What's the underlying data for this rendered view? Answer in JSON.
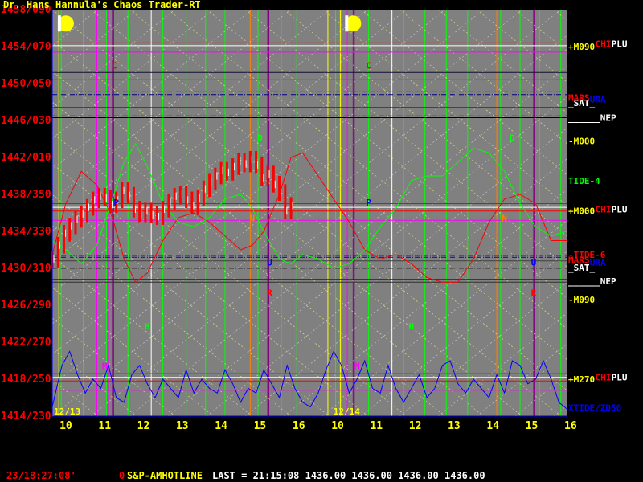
{
  "app": {
    "title": "Dr. Hans Hannula's Chaos Trader-RT"
  },
  "status": {
    "clock": "23/18:27:08'",
    "flag": "0",
    "symbol": "S&P-AMHOTLINE",
    "quote": "LAST = 21:15:08 1436.00 1436.00 1436.00 1436.00"
  },
  "colors": {
    "background": "#000000",
    "plot_bg": "#808080",
    "title": "#ffff00",
    "y_labels": "#ff0000",
    "x_labels": "#ffff00",
    "price_bars": "#ff0000",
    "price_up": "#ffffff",
    "tide": "#ff0000",
    "tide4": "#00ff00",
    "xtide": "#0000ff",
    "xtide_label": "#0000ff",
    "moon": "#ffff00",
    "time_text": "#ff0000",
    "symbol_text": "#ffff00",
    "quote_text": "#ffffff"
  },
  "chart_data": {
    "type": "line",
    "title": "Dr. Hans Hannula's Chaos Trader-RT",
    "y_tick_labels": [
      "1458/090",
      "1454/070",
      "1450/050",
      "1446/030",
      "1442/010",
      "1438/350",
      "1434/330",
      "1430/310",
      "1426/290",
      "1422/270",
      "1418/250",
      "1414/230"
    ],
    "y_ticks": [
      1458,
      1454,
      1450,
      1446,
      1442,
      1438,
      1434,
      1430,
      1426,
      1422,
      1418,
      1414
    ],
    "ylim": [
      1414,
      1458
    ],
    "x_tick_labels": [
      "10",
      "11",
      "12",
      "13",
      "14",
      "15",
      "16",
      "10",
      "11",
      "12",
      "13",
      "14",
      "15",
      "16"
    ],
    "x_ticks": [
      9.5,
      10.5,
      11.5,
      12.5,
      13.5,
      14.5,
      15.5,
      16.5,
      17.5,
      18.5,
      19.5,
      20.5,
      21.5,
      22.5
    ],
    "xlim": [
      9.15,
      22.4
    ],
    "date_labels": [
      {
        "text": "12/13",
        "x": 9.15
      },
      {
        "text": "12/14",
        "x": 16.35
      }
    ],
    "right_labels": [
      {
        "text": "+M090",
        "y": 1454.0,
        "color": "#ffff00"
      },
      {
        "text": "CHI",
        "y": 1454.3,
        "color": "#ff0000"
      },
      {
        "text": "PLU",
        "y": 1454.3,
        "color": "#ffffff"
      },
      {
        "text": "_SAT_",
        "y": 1447.9,
        "color": "#ffffff"
      },
      {
        "text": "MARS",
        "y": 1448.5,
        "color": "#ff0000"
      },
      {
        "text": "URA",
        "y": 1448.3,
        "color": "#0000ff"
      },
      {
        "text": "______NEP",
        "y": 1446.3,
        "color": "#ffffff"
      },
      {
        "text": "-M000",
        "y": 1443.8,
        "color": "#ffff00"
      },
      {
        "text": "TIDE-4",
        "y": 1439.5,
        "color": "#00ff00"
      },
      {
        "text": "+M000",
        "y": 1436.2,
        "color": "#ffff00"
      },
      {
        "text": "CHI",
        "y": 1436.4,
        "color": "#ff0000"
      },
      {
        "text": "PLU",
        "y": 1436.4,
        "color": "#ffffff"
      },
      {
        "text": "-TIDE-6",
        "y": 1431.5,
        "color": "#ff0000"
      },
      {
        "text": "MARS",
        "y": 1430.9,
        "color": "#ff0000"
      },
      {
        "text": "URA",
        "y": 1430.6,
        "color": "#0000ff"
      },
      {
        "text": "_SAT_",
        "y": 1430.1,
        "color": "#ffffff"
      },
      {
        "text": "______NEP",
        "y": 1428.6,
        "color": "#ffffff"
      },
      {
        "text": "-M090",
        "y": 1426.6,
        "color": "#ffff00"
      },
      {
        "text": "+M270",
        "y": 1418.0,
        "color": "#ffff00"
      },
      {
        "text": "CHI",
        "y": 1418.2,
        "color": "#ff0000"
      },
      {
        "text": "PLU",
        "y": 1418.2,
        "color": "#ffffff"
      },
      {
        "text": "XTIDE/ZD50",
        "y": 1414.9,
        "color": "#0000ff"
      }
    ],
    "h_lines": [
      {
        "y": 1455.7,
        "color": "#ff0000",
        "style": "solid"
      },
      {
        "y": 1454.4,
        "color": "#ff0000",
        "style": "solid"
      },
      {
        "y": 1454.1,
        "color": "#ffffff",
        "style": "solid"
      },
      {
        "y": 1453.4,
        "color": "#ff00ff",
        "style": "solid"
      },
      {
        "y": 1451.2,
        "color": "#101030",
        "style": "solid"
      },
      {
        "y": 1450.4,
        "color": "#303030",
        "style": "solid"
      },
      {
        "y": 1449.1,
        "color": "#0000aa",
        "style": "dashed"
      },
      {
        "y": 1448.8,
        "color": "#000080",
        "style": "dashed"
      },
      {
        "y": 1447.4,
        "color": "#202020",
        "style": "solid"
      },
      {
        "y": 1446.5,
        "color": "#303030",
        "style": "dashed"
      },
      {
        "y": 1446.3,
        "color": "#000000",
        "style": "solid"
      },
      {
        "y": 1437.0,
        "color": "#ff0000",
        "style": "solid"
      },
      {
        "y": 1436.6,
        "color": "#ffffff",
        "style": "solid"
      },
      {
        "y": 1436.2,
        "color": "#ff0000",
        "style": "solid"
      },
      {
        "y": 1435.2,
        "color": "#ff00ff",
        "style": "solid"
      },
      {
        "y": 1431.4,
        "color": "#000080",
        "style": "dashed"
      },
      {
        "y": 1431.2,
        "color": "#0000aa",
        "style": "dashed"
      },
      {
        "y": 1430.8,
        "color": "#404040",
        "style": "solid"
      },
      {
        "y": 1430.0,
        "color": "#303030",
        "style": "dashed"
      },
      {
        "y": 1428.8,
        "color": "#202020",
        "style": "solid"
      },
      {
        "y": 1428.5,
        "color": "#303030",
        "style": "solid"
      },
      {
        "y": 1418.6,
        "color": "#ff0000",
        "style": "solid"
      },
      {
        "y": 1418.2,
        "color": "#ffffff",
        "style": "solid"
      },
      {
        "y": 1417.8,
        "color": "#ff0000",
        "style": "solid"
      },
      {
        "y": 1416.8,
        "color": "#ff00ff",
        "style": "solid"
      }
    ],
    "v_lines": [
      {
        "x": 9.32,
        "color": "#ffff00"
      },
      {
        "x": 9.38,
        "color": "#00ff00"
      },
      {
        "x": 9.95,
        "color": "#00ff00"
      },
      {
        "x": 10.3,
        "color": "#ff00ff"
      },
      {
        "x": 10.55,
        "color": "#00ff00"
      },
      {
        "x": 10.58,
        "color": "#ff00ff"
      },
      {
        "x": 10.7,
        "color": "#800080"
      },
      {
        "x": 10.73,
        "color": "#800080"
      },
      {
        "x": 11.1,
        "color": "#00ff00"
      },
      {
        "x": 11.7,
        "color": "#ffffff"
      },
      {
        "x": 12.0,
        "color": "#00ff00"
      },
      {
        "x": 12.6,
        "color": "#00ff00"
      },
      {
        "x": 13.1,
        "color": "#00ff00"
      },
      {
        "x": 13.6,
        "color": "#00ff00"
      },
      {
        "x": 14.25,
        "color": "#ff8000"
      },
      {
        "x": 14.45,
        "color": "#00ff00"
      },
      {
        "x": 14.7,
        "color": "#800080"
      },
      {
        "x": 14.73,
        "color": "#800080"
      },
      {
        "x": 15.05,
        "color": "#00ff00"
      },
      {
        "x": 15.35,
        "color": "#000000"
      },
      {
        "x": 15.45,
        "color": "#00ff00"
      },
      {
        "x": 16.25,
        "color": "#ffff00"
      },
      {
        "x": 16.45,
        "color": "#00ff00"
      },
      {
        "x": 16.57,
        "color": "#ffff00"
      },
      {
        "x": 16.6,
        "color": "#00ff00"
      },
      {
        "x": 16.75,
        "color": "#ff00ff"
      },
      {
        "x": 16.9,
        "color": "#800080"
      },
      {
        "x": 16.93,
        "color": "#800080"
      },
      {
        "x": 17.3,
        "color": "#00ff00"
      },
      {
        "x": 17.9,
        "color": "#ffffff"
      },
      {
        "x": 18.2,
        "color": "#00ff00"
      },
      {
        "x": 18.75,
        "color": "#00ff00"
      },
      {
        "x": 19.3,
        "color": "#00ff00"
      },
      {
        "x": 19.85,
        "color": "#00ff00"
      },
      {
        "x": 20.6,
        "color": "#ff8000"
      },
      {
        "x": 20.7,
        "color": "#00ff00"
      },
      {
        "x": 21.2,
        "color": "#00ff00"
      },
      {
        "x": 21.55,
        "color": "#800080"
      },
      {
        "x": 21.58,
        "color": "#800080"
      },
      {
        "x": 21.7,
        "color": "#00ff00"
      },
      {
        "x": 22.25,
        "color": "#00ff00"
      }
    ],
    "planet_markers": [
      {
        "text": "C",
        "x": 10.75,
        "y": 1451.6,
        "color": "#ff0000"
      },
      {
        "text": "D",
        "x": 14.5,
        "y": 1443.8,
        "color": "#00ff00"
      },
      {
        "text": "P",
        "x": 10.8,
        "y": 1436.8,
        "color": "#0000ff"
      },
      {
        "text": "N",
        "x": 14.3,
        "y": 1435.1,
        "color": "#ff8000"
      },
      {
        "text": "U",
        "x": 14.75,
        "y": 1430.3,
        "color": "#0000ff"
      },
      {
        "text": "R",
        "x": 14.75,
        "y": 1427.0,
        "color": "#ff0000"
      },
      {
        "text": "H",
        "x": 11.6,
        "y": 1423.4,
        "color": "#00ff00"
      },
      {
        "text": "M",
        "x": 10.5,
        "y": 1419.1,
        "color": "#ff00ff"
      },
      {
        "text": "C",
        "x": 17.3,
        "y": 1451.6,
        "color": "#ff0000"
      },
      {
        "text": "D",
        "x": 21.0,
        "y": 1443.8,
        "color": "#00ff00"
      },
      {
        "text": "P",
        "x": 17.3,
        "y": 1436.8,
        "color": "#0000ff"
      },
      {
        "text": "N",
        "x": 20.8,
        "y": 1435.1,
        "color": "#ff8000"
      },
      {
        "text": "U",
        "x": 21.55,
        "y": 1430.3,
        "color": "#0000ff"
      },
      {
        "text": "R",
        "x": 21.55,
        "y": 1427.0,
        "color": "#ff0000"
      },
      {
        "text": "H",
        "x": 18.4,
        "y": 1423.4,
        "color": "#00ff00"
      },
      {
        "text": "M",
        "x": 17.0,
        "y": 1419.1,
        "color": "#ff00ff"
      }
    ],
    "moon_markers": [
      {
        "x": 9.5,
        "y": 1456.5
      },
      {
        "x": 16.9,
        "y": 1456.5
      }
    ],
    "series": [
      {
        "name": "TIDE-6",
        "color": "#ff0000",
        "x": [
          9.15,
          9.5,
          9.9,
          10.3,
          10.7,
          11.0,
          11.3,
          11.6,
          12.0,
          12.4,
          12.8,
          13.2,
          13.6,
          14.0,
          14.3,
          14.6,
          15.0,
          15.3,
          15.6,
          16.0,
          16.4,
          16.8,
          17.2,
          17.6,
          18.0,
          18.4,
          18.8,
          19.2,
          19.6,
          20.0,
          20.4,
          20.8,
          21.2,
          21.6,
          22.0,
          22.4
        ],
        "y": [
          1431.5,
          1437.0,
          1440.5,
          1439.0,
          1435.5,
          1431.0,
          1428.5,
          1429.5,
          1433.0,
          1435.5,
          1436.0,
          1435.0,
          1433.5,
          1432.0,
          1432.5,
          1434.0,
          1438.0,
          1442.0,
          1442.5,
          1440.0,
          1437.5,
          1435.0,
          1432.0,
          1431.0,
          1431.5,
          1430.5,
          1429.0,
          1428.5,
          1428.5,
          1431.0,
          1435.0,
          1437.5,
          1438.0,
          1437.0,
          1433.0,
          1433.0
        ]
      },
      {
        "name": "TIDE-4",
        "color": "#00ff00",
        "x": [
          9.15,
          9.5,
          9.9,
          10.3,
          10.7,
          11.0,
          11.3,
          11.6,
          12.0,
          12.4,
          12.8,
          13.2,
          13.6,
          14.0,
          14.3,
          14.6,
          15.0,
          15.3,
          15.6,
          16.0,
          16.4,
          16.8,
          17.2,
          17.6,
          18.0,
          18.4,
          18.8,
          19.2,
          19.6,
          20.0,
          20.4,
          20.8,
          21.2,
          21.6,
          22.0,
          22.4
        ],
        "y": [
          1433.0,
          1432.0,
          1430.5,
          1432.5,
          1437.5,
          1441.5,
          1443.5,
          1441.0,
          1437.0,
          1435.0,
          1434.5,
          1435.5,
          1437.5,
          1438.0,
          1436.5,
          1434.0,
          1431.0,
          1430.5,
          1431.5,
          1431.0,
          1430.0,
          1430.5,
          1432.0,
          1434.5,
          1436.5,
          1439.5,
          1440.0,
          1440.0,
          1441.5,
          1443.0,
          1442.5,
          1440.5,
          1437.0,
          1434.5,
          1433.5,
          1434.0
        ]
      },
      {
        "name": "XTIDE/ZD50",
        "color": "#0000ff",
        "x": [
          9.15,
          9.4,
          9.6,
          9.8,
          10.0,
          10.2,
          10.4,
          10.6,
          10.8,
          11.0,
          11.2,
          11.4,
          11.6,
          11.8,
          12.0,
          12.2,
          12.4,
          12.6,
          12.8,
          13.0,
          13.2,
          13.4,
          13.6,
          13.8,
          14.0,
          14.2,
          14.4,
          14.6,
          14.8,
          15.0,
          15.2,
          15.4,
          15.6,
          15.8,
          16.0,
          16.2,
          16.4,
          16.6,
          16.8,
          17.0,
          17.2,
          17.4,
          17.6,
          17.8,
          18.0,
          18.2,
          18.4,
          18.6,
          18.8,
          19.0,
          19.2,
          19.4,
          19.6,
          19.8,
          20.0,
          20.2,
          20.4,
          20.6,
          20.8,
          21.0,
          21.2,
          21.4,
          21.6,
          21.8,
          22.0,
          22.2,
          22.4
        ],
        "y": [
          1415.0,
          1419.5,
          1421.0,
          1418.5,
          1416.5,
          1418.0,
          1417.0,
          1419.5,
          1416.0,
          1415.5,
          1418.5,
          1419.5,
          1417.5,
          1416.0,
          1418.0,
          1417.0,
          1416.0,
          1419.0,
          1416.5,
          1418.0,
          1417.0,
          1416.5,
          1419.0,
          1417.5,
          1415.5,
          1417.0,
          1416.5,
          1419.0,
          1417.5,
          1416.0,
          1419.5,
          1417.0,
          1415.5,
          1415.0,
          1416.5,
          1419.0,
          1421.0,
          1419.5,
          1416.5,
          1418.0,
          1420.0,
          1417.0,
          1416.5,
          1419.5,
          1417.0,
          1415.5,
          1417.0,
          1418.5,
          1416.0,
          1417.0,
          1419.5,
          1420.0,
          1417.5,
          1416.5,
          1418.0,
          1417.0,
          1416.0,
          1418.5,
          1416.5,
          1420.0,
          1419.5,
          1417.5,
          1418.0,
          1420.0,
          1418.0,
          1415.5,
          1414.8
        ]
      },
      {
        "name": "Price",
        "color": "#ff0000",
        "x": [
          9.15,
          9.3,
          9.45,
          9.6,
          9.75,
          9.9,
          10.05,
          10.2,
          10.35,
          10.5,
          10.65,
          10.8,
          10.95,
          11.1,
          11.25,
          11.4,
          11.55,
          11.7,
          11.85,
          12.0,
          12.15,
          12.3,
          12.45,
          12.6,
          12.75,
          12.9,
          13.05,
          13.2,
          13.35,
          13.5,
          13.65,
          13.8,
          13.95,
          14.1,
          14.25,
          14.4,
          14.55,
          14.7,
          14.85,
          15.0,
          15.15,
          15.3
        ],
        "y": [
          1431.0,
          1432.5,
          1433.8,
          1434.6,
          1435.3,
          1435.9,
          1436.6,
          1437.4,
          1437.8,
          1437.6,
          1436.9,
          1437.4,
          1438.4,
          1437.9,
          1436.4,
          1435.9,
          1436.2,
          1435.8,
          1435.6,
          1436.4,
          1437.2,
          1437.8,
          1438.0,
          1437.4,
          1436.8,
          1437.6,
          1438.6,
          1439.4,
          1440.0,
          1440.6,
          1440.4,
          1441.0,
          1441.6,
          1441.3,
          1441.8,
          1441.2,
          1439.8,
          1440.2,
          1439.1,
          1438.2,
          1436.2,
          1436.8
        ]
      }
    ]
  }
}
